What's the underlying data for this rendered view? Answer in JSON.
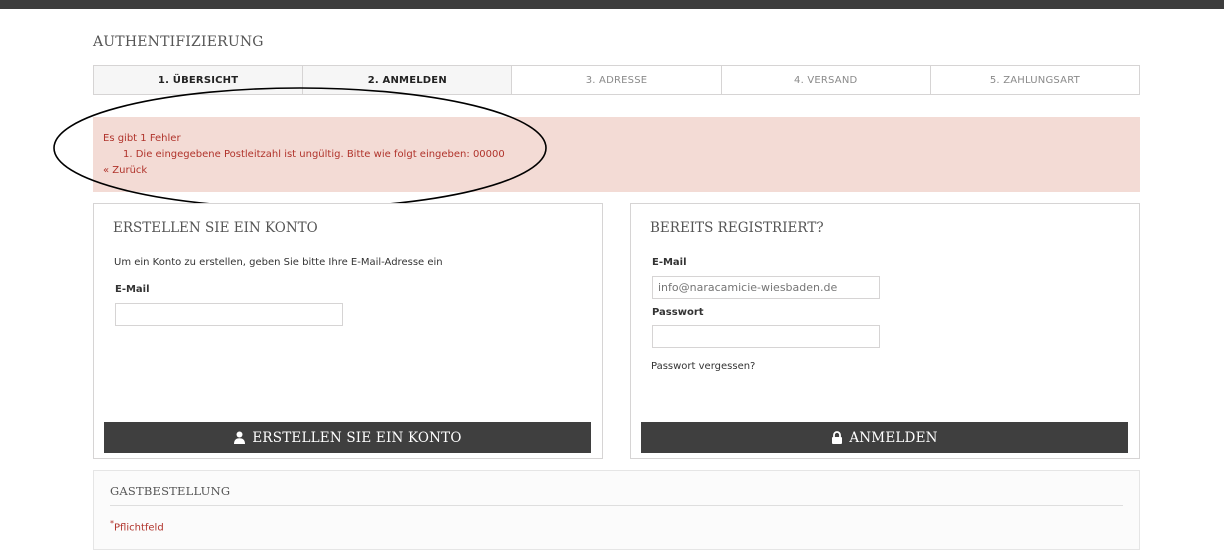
{
  "page": {
    "title": "AUTHENTIFIZIERUNG"
  },
  "steps": [
    {
      "label": "1. ÜBERSICHT",
      "state": "done"
    },
    {
      "label": "2. ANMELDEN",
      "state": "current"
    },
    {
      "label": "3. ADRESSE",
      "state": "todo"
    },
    {
      "label": "4. VERSAND",
      "state": "todo"
    },
    {
      "label": "5. ZAHLUNGSART",
      "state": "todo"
    }
  ],
  "error": {
    "summary": "Es gibt 1 Fehler",
    "items": [
      "1. Die eingegebene Postleitzahl ist ungültig. Bitte wie folgt eingeben: 00000"
    ],
    "back_link": "« Zurück"
  },
  "create_account": {
    "heading": "ERSTELLEN SIE EIN KONTO",
    "description": "Um ein Konto zu erstellen, geben Sie bitte Ihre E-Mail-Adresse ein",
    "email_label": "E-Mail",
    "email_value": "",
    "button_label": "ERSTELLEN SIE EIN KONTO",
    "button_icon": "user-icon"
  },
  "login": {
    "heading": "BEREITS REGISTRIERT?",
    "email_label": "E-Mail",
    "email_placeholder": "info@naracamicie-wiesbaden.de",
    "password_label": "Passwort",
    "password_value": "",
    "forgot_link": "Passwort vergessen?",
    "button_label": "ANMELDEN",
    "button_icon": "lock-icon"
  },
  "guest": {
    "heading": "GASTBESTELLUNG",
    "required_marker": "*",
    "required_note": "Pflichtfeld"
  },
  "colors": {
    "error_bg": "#f3dbd5",
    "error_text": "#b0332b",
    "button_bg": "#3f3f3f",
    "topbar": "#3d3d3d"
  }
}
